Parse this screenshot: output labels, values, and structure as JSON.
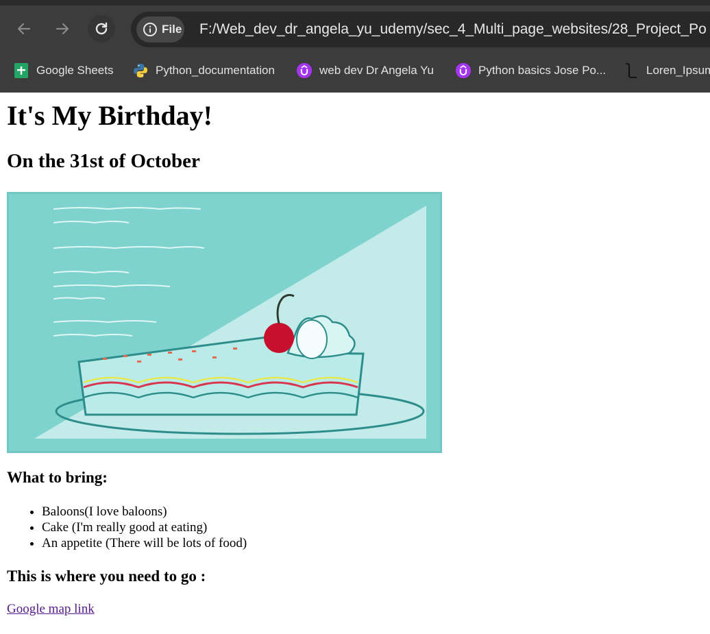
{
  "browser": {
    "address_chip": "File",
    "url": "F:/Web_dev_dr_angela_yu_udemy/sec_4_Multi_page_websites/28_Project_Po",
    "bookmarks": [
      {
        "label": "Google Sheets",
        "icon": "google-sheets-icon"
      },
      {
        "label": "Python_documentation",
        "icon": "python-icon"
      },
      {
        "label": "web dev Dr Angela Yu",
        "icon": "udemy-icon"
      },
      {
        "label": "Python basics Jose Po...",
        "icon": "udemy-icon"
      },
      {
        "label": "Loren_Ipsum",
        "icon": "lorem-ipsum-icon"
      }
    ]
  },
  "page": {
    "title": "It's My Birthday!",
    "subtitle": "On the 31st of October",
    "bring_heading": "What to bring:",
    "bring_items": [
      "Baloons(I love baloons)",
      "Cake (I'm really good at eating)",
      "An appetite (There will be lots of food)"
    ],
    "go_heading": "This is where you need to go :",
    "map_link": "Google map link"
  },
  "colors": {
    "chrome_bg": "#3c3c3c",
    "invite_teal": "#7fd3cf",
    "link_visited": "#551a8b",
    "udemy_purple": "#a435f0"
  }
}
